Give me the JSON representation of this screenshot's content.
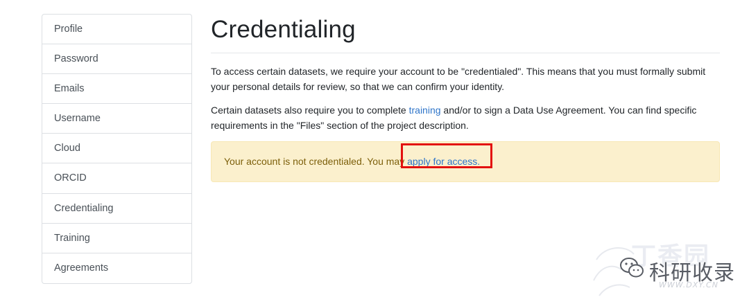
{
  "sidebar": {
    "items": [
      {
        "label": "Profile"
      },
      {
        "label": "Password"
      },
      {
        "label": "Emails"
      },
      {
        "label": "Username"
      },
      {
        "label": "Cloud"
      },
      {
        "label": "ORCID"
      },
      {
        "label": "Credentialing"
      },
      {
        "label": "Training"
      },
      {
        "label": "Agreements"
      }
    ]
  },
  "main": {
    "title": "Credentialing",
    "para1": "To access certain datasets, we require your account to be \"credentialed\". This means that you must formally submit your personal details for review, so that we can confirm your identity.",
    "para2_before": "Certain datasets also require you to complete ",
    "para2_link": "training",
    "para2_after": " and/or to sign a Data Use Agreement. You can find specific requirements in the \"Files\" section of the project description.",
    "alert_text": "Your account is not credentialed. You may ",
    "alert_link": "apply for access."
  },
  "colors": {
    "link": "#2f75c9",
    "alert_bg": "#fbf0cd",
    "alert_text": "#7c5f0a",
    "highlight": "#e3110f"
  },
  "watermark": {
    "text": "科研收录",
    "url": "WWW.DXY.CN",
    "ghost": "丁香园",
    "icon": "wechat-icon"
  }
}
